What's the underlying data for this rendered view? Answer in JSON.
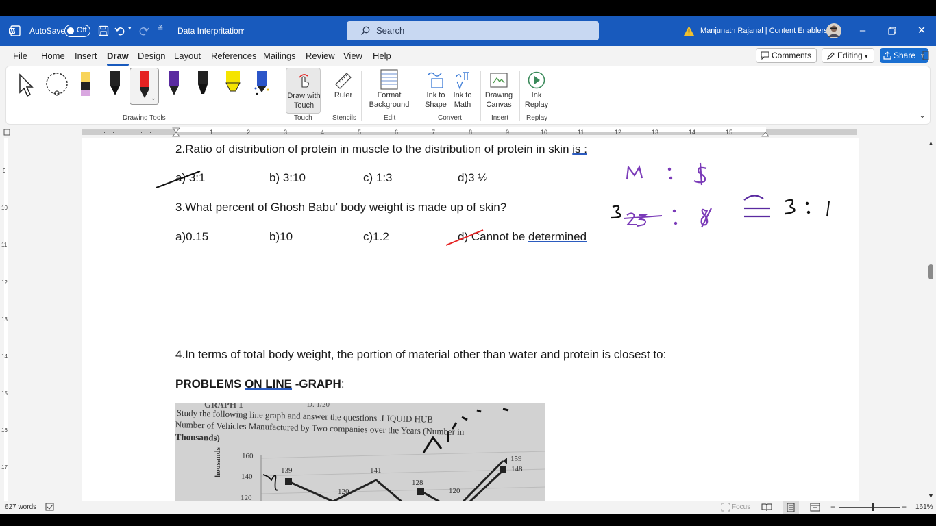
{
  "titlebar": {
    "autosave_label": "AutoSave",
    "autosave_state": "Off",
    "doc_title": "Data Interpritation",
    "search_placeholder": "Search",
    "user_name": "Manjunath Rajanal | Content Enablers"
  },
  "menu": {
    "tabs": [
      "File",
      "Home",
      "Insert",
      "Draw",
      "Design",
      "Layout",
      "References",
      "Mailings",
      "Review",
      "View",
      "Help"
    ],
    "active": "Draw",
    "comments": "Comments",
    "editing": "Editing",
    "share": "Share"
  },
  "ribbon": {
    "groups": {
      "drawing_tools": "Drawing Tools",
      "touch": "Touch",
      "stencils": "Stencils",
      "edit": "Edit",
      "convert": "Convert",
      "insert": "Insert",
      "replay": "Replay"
    },
    "buttons": {
      "draw_with_touch_1": "Draw with",
      "draw_with_touch_2": "Touch",
      "ruler": "Ruler",
      "format_bg_1": "Format",
      "format_bg_2": "Background",
      "ink_to_shape_1": "Ink to",
      "ink_to_shape_2": "Shape",
      "ink_to_math_1": "Ink to",
      "ink_to_math_2": "Math",
      "drawing_canvas_1": "Drawing",
      "drawing_canvas_2": "Canvas",
      "ink_replay_1": "Ink",
      "ink_replay_2": "Replay"
    },
    "pen_colors": [
      "#111111",
      "#e52222",
      "#5a2aa0",
      "#111111",
      "#f5e400",
      "#2b55c8"
    ]
  },
  "ruler": {
    "h_numbers": [
      "1",
      "2",
      "3",
      "4",
      "5",
      "6",
      "7",
      "8",
      "9",
      "10",
      "11",
      "12",
      "13",
      "14",
      "15"
    ],
    "v_numbers": [
      "9",
      "10",
      "11",
      "12",
      "13",
      "14",
      "15",
      "16",
      "17"
    ]
  },
  "document": {
    "q2": "2.Ratio of distribution of protein in muscle to the distribution of protein in skin",
    "q2_tail": "is :",
    "q2_a": "a) 3:1",
    "q2_b": "b) 3:10",
    "q2_c": "c) 1:3",
    "q2_d": "d)3 ½",
    "q3": "3.What percent of Ghosh Babu’ body weight is made up of skin?",
    "q3_a": "a)0.15",
    "q3_b": "b)10",
    "q3_c": "c)1.2",
    "q3_d_pre": "d) Cannot be",
    "q3_d_tail": "determined",
    "q4": "4.In terms of total body weight, the portion of material other than water and protein is closest to:",
    "heading_pre": "PROBLEMS",
    "heading_mid": "ON LINE",
    "heading_post": "-GRAPH",
    "heading_colon": ":",
    "photo": {
      "top_left": "GRAPH 1",
      "top_right": "D. 1/20",
      "line1": "Study the following line graph and answer the questions .LIQUID HUB",
      "line2": "Number of Vehicles Manufactured by Two companies over the Years (Number in",
      "line3": "Thousands)",
      "y_ticks": [
        "160",
        "140",
        "120"
      ],
      "y_label": "housands",
      "labels": [
        "139",
        "141",
        "128",
        "120",
        "120",
        "159",
        "148"
      ]
    },
    "ink": {
      "left": "M : S",
      "lower": "3 25 : 8",
      "result": "≅ 3 : 1"
    }
  },
  "status": {
    "words": "627 words",
    "focus": "Focus",
    "zoom": "161%"
  }
}
